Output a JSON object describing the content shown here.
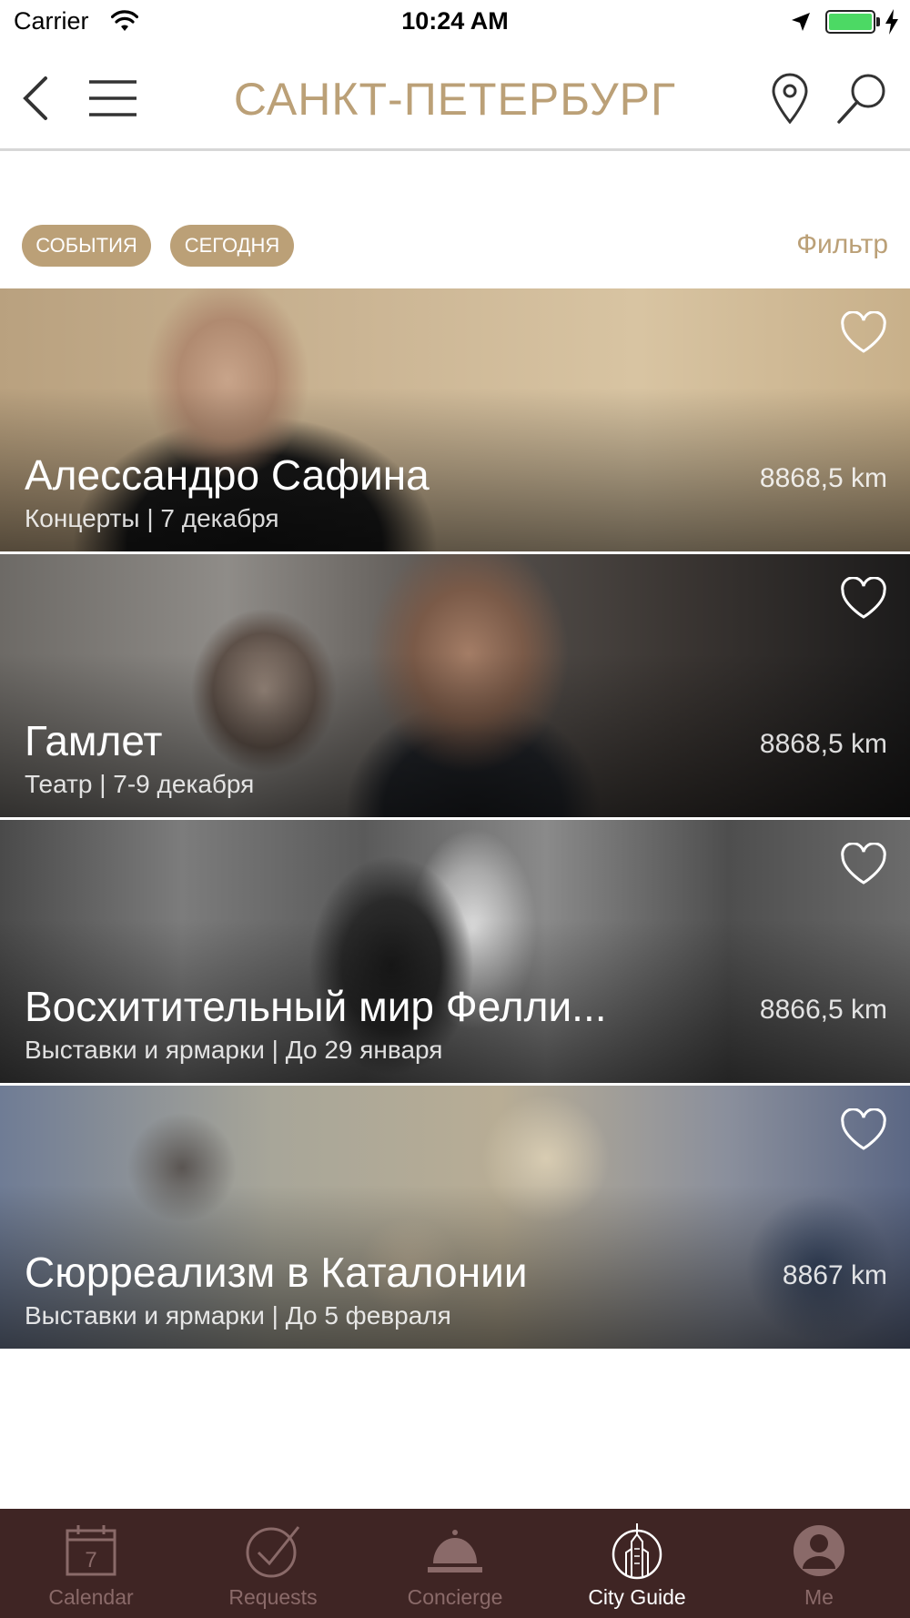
{
  "status_bar": {
    "carrier": "Carrier",
    "time": "10:24 AM",
    "battery_color": "#4cd964"
  },
  "nav": {
    "title": "САНКТ-ПЕТЕРБУРГ",
    "accent_color": "#bba077",
    "left_icons": [
      "back-chevron-icon",
      "hamburger-menu-icon"
    ],
    "right_icons": [
      "map-pin-icon",
      "search-icon"
    ]
  },
  "filters": {
    "chips": [
      {
        "label": "СОБЫТИЯ"
      },
      {
        "label": "СЕГОДНЯ"
      }
    ],
    "filter_label": "Фильтр"
  },
  "events": [
    {
      "title": "Алессандро Сафина",
      "subtitle": "Концерты | 7 декабря",
      "distance": "8868,5 km",
      "favorite_icon": "heart-outline-icon"
    },
    {
      "title": "Гамлет",
      "subtitle": "Театр | 7-9 декабря",
      "distance": "8868,5 km",
      "favorite_icon": "heart-outline-icon"
    },
    {
      "title": "Восхитительный мир Фелли...",
      "subtitle": "Выставки и ярмарки | До 29 января",
      "distance": "8866,5 km",
      "favorite_icon": "heart-outline-icon"
    },
    {
      "title": "Сюрреализм в Каталонии",
      "subtitle": "Выставки и ярмарки | До 5 февраля",
      "distance": "8867 km",
      "favorite_icon": "heart-outline-icon"
    }
  ],
  "tab_bar": {
    "background": "#3f2524",
    "tabs": [
      {
        "label": "Calendar",
        "icon": "calendar-icon",
        "calendar_day": "7",
        "active": false
      },
      {
        "label": "Requests",
        "icon": "checkmark-circle-icon",
        "active": false
      },
      {
        "label": "Concierge",
        "icon": "concierge-bell-icon",
        "active": false
      },
      {
        "label": "City Guide",
        "icon": "skyscraper-icon",
        "active": true
      },
      {
        "label": "Me",
        "icon": "user-avatar-icon",
        "active": false
      }
    ]
  }
}
